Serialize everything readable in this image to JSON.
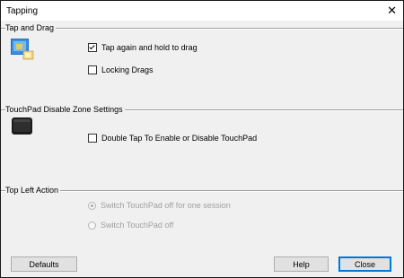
{
  "window": {
    "title": "Tapping"
  },
  "sections": {
    "tap_and_drag": {
      "label": "Tap and Drag",
      "icon": "touchpad-tap-icon",
      "options": [
        {
          "label": "Tap again and hold to drag",
          "checked": true
        },
        {
          "label": "Locking Drags",
          "checked": false
        }
      ]
    },
    "disable_zone": {
      "label": "TouchPad Disable Zone Settings",
      "icon": "touchpad-device-icon",
      "options": [
        {
          "label": "Double Tap To Enable or Disable TouchPad",
          "checked": false
        }
      ]
    },
    "top_left_action": {
      "label": "Top Left Action",
      "options": [
        {
          "label": "Switch TouchPad off for one session",
          "selected": true,
          "enabled": false
        },
        {
          "label": "Switch TouchPad off",
          "selected": false,
          "enabled": false
        }
      ]
    }
  },
  "buttons": {
    "defaults": "Defaults",
    "help": "Help",
    "close": "Close"
  },
  "colors": {
    "focus_border": "#0078d7",
    "disabled_text": "#a0a0a0"
  }
}
